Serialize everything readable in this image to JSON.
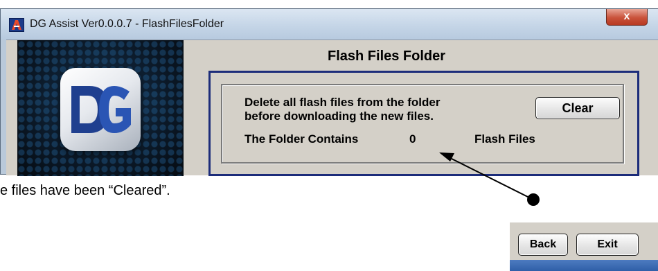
{
  "window": {
    "title": "DG Assist Ver0.0.0.7 - FlashFilesFolder",
    "close_label": "x"
  },
  "section": {
    "title": "Flash Files Folder"
  },
  "group": {
    "line1": "Delete all flash files from the folder",
    "line2": "before downloading the new files.",
    "contains_label": "The Folder Contains",
    "file_count": "0",
    "unit_label": "Flash Files",
    "clear_label": "Clear"
  },
  "caption": "e files have been “Cleared”.",
  "footer": {
    "back_label": "Back",
    "exit_label": "Exit"
  },
  "colors": {
    "group_border": "#1c2c7a",
    "window_gray": "#d4d0c8",
    "close_red": "#c9523a"
  },
  "icons": {
    "app_icon": "dg-assist-app-icon",
    "logo": "dg-logo",
    "close": "close-icon"
  }
}
